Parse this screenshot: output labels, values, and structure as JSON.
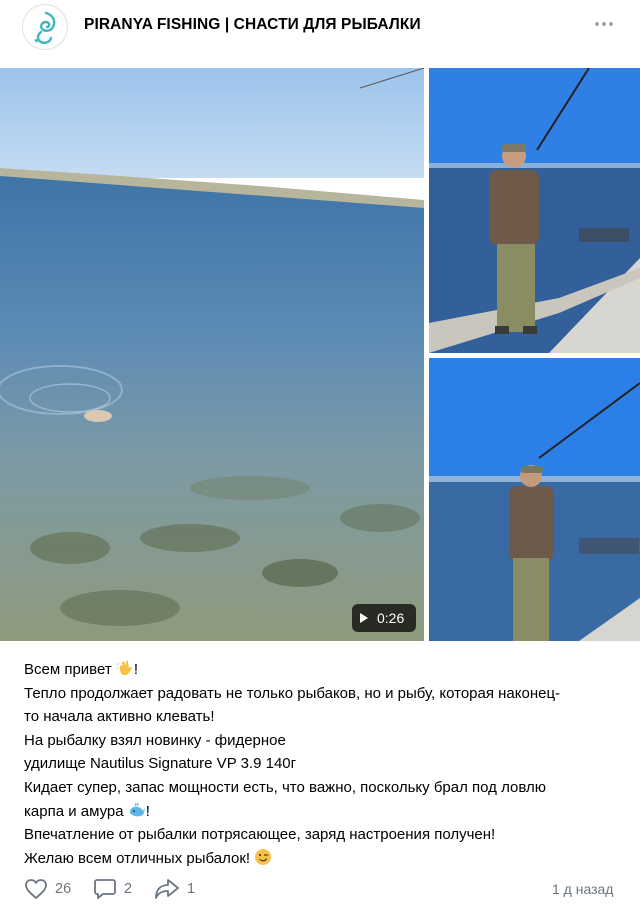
{
  "post": {
    "author": "PIRANYA FISHING | СНАСТИ ДЛЯ РЫБАЛКИ",
    "avatar_icon": "fish-logo-icon",
    "more_icon": "more-dots-icon"
  },
  "media": {
    "video_duration": "0:26",
    "play_icon": "play-icon"
  },
  "text": {
    "line1": "Всем привет",
    "line1_end": "!",
    "line2": "Тепло продолжает радовать не только рыбаков, но и рыбу, которая наконец-",
    "line3": "то начала активно клевать!",
    "line4": "На рыбалку взял новинку - фидерное",
    "line5": "удилище Nautilus Signature VP 3.9 140г",
    "line6": "Кидает супер, запас мощности есть, что важно, поскольку брал под ловлю",
    "line7": "карпа и амура",
    "line7_end": "!",
    "line8": "Впечатление от рыбалки потрясающее, заряд настроения получен!",
    "line9": "Желаю всем отличных рыбалок!"
  },
  "footer": {
    "likes": "26",
    "comments": "2",
    "shares": "1",
    "time": "1 д назад"
  },
  "colors": {
    "accent_blue": "#2a5885",
    "muted": "#6b7580"
  }
}
